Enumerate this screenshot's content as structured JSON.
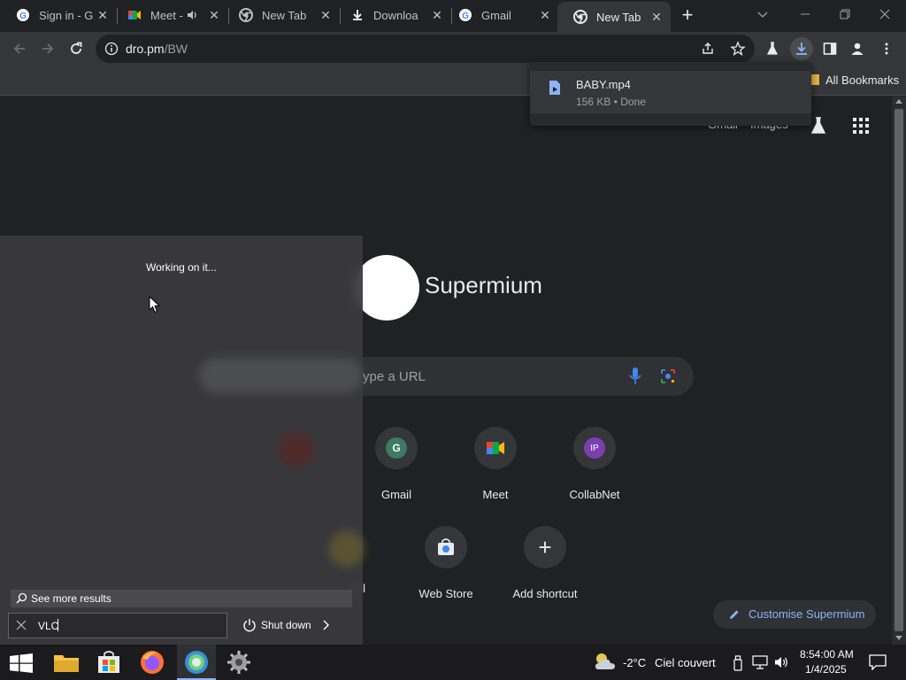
{
  "tabs": [
    {
      "title": "Sign in - G",
      "icon": "google-icon"
    },
    {
      "title": "Meet -",
      "icon": "meet-icon",
      "muted_icon": "speaker-icon"
    },
    {
      "title": "New Tab",
      "icon": "chrome-icon"
    },
    {
      "title": "Downloa",
      "icon": "download-icon"
    },
    {
      "title": "Gmail",
      "icon": "google-icon"
    },
    {
      "title": "New Tab",
      "icon": "chrome-icon",
      "active": true
    }
  ],
  "toolbar": {
    "url_host": "dro.pm",
    "url_path": "/BW"
  },
  "bookmarks": {
    "all_bookmarks": "All Bookmarks"
  },
  "download": {
    "filename": "BABY.mp4",
    "status": "156 KB • Done"
  },
  "ntp": {
    "top_links": [
      "Gmail",
      "Images"
    ],
    "logo_text": "Supermium",
    "search_placeholder": "ype a URL",
    "shortcuts": [
      {
        "label": "Gmail",
        "letter": "G",
        "color": "#3e7b63"
      },
      {
        "label": "Meet",
        "letter": "",
        "color": ""
      },
      {
        "label": "CollabNet",
        "letter": "IP",
        "color": "#7b3fb0"
      },
      {
        "label": "ail",
        "letter": "",
        "color": ""
      },
      {
        "label": "Web Store",
        "letter": "",
        "color": ""
      },
      {
        "label": "Add shortcut",
        "letter": "+",
        "color": ""
      }
    ],
    "customise": "Customise Supermium"
  },
  "startmenu": {
    "status": "Working on it...",
    "see_more": "See more results",
    "search_value": "VLC",
    "shutdown": "Shut down"
  },
  "taskbar": {
    "temperature": "-2°C",
    "weather": "Ciel couvert",
    "time": "8:54:00 AM",
    "date": "1/4/2025"
  },
  "colors": {
    "accent": "#8ab4f8",
    "tab_active": "#35363a",
    "background": "#202124"
  }
}
